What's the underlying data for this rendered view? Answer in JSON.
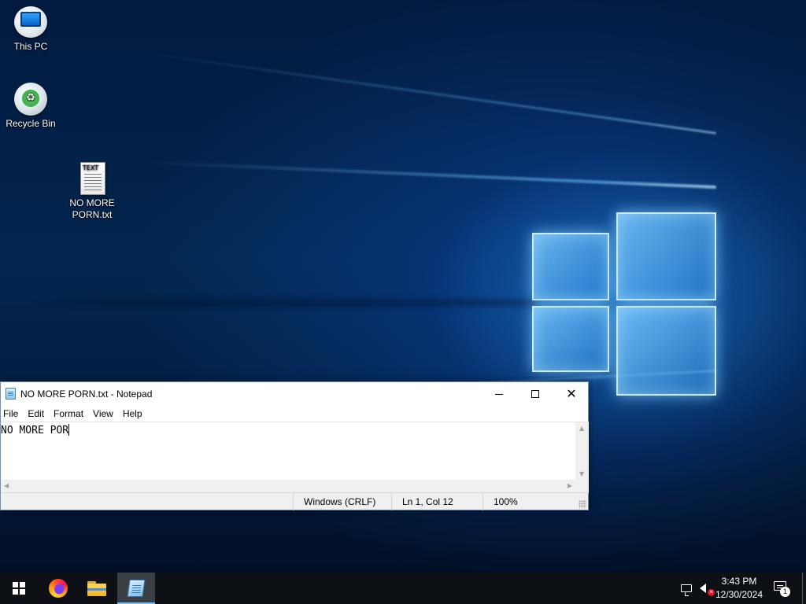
{
  "desktop": {
    "icons": [
      {
        "label": "This PC",
        "icon": "this-pc-icon"
      },
      {
        "label": "Recycle Bin",
        "icon": "recycle-bin-icon"
      },
      {
        "label": "NO MORE PORN.txt",
        "label_line1": "NO MORE",
        "label_line2": "PORN.txt",
        "icon": "text-file-icon",
        "badge": "TEXT"
      }
    ]
  },
  "notepad": {
    "title": "NO MORE PORN.txt - Notepad",
    "menu": [
      "File",
      "Edit",
      "Format",
      "View",
      "Help"
    ],
    "content": "NO MORE POR",
    "status": {
      "encoding": "Windows (CRLF)",
      "position": "Ln 1, Col 12",
      "zoom": "100%"
    }
  },
  "taskbar": {
    "pinned": [
      {
        "name": "Start",
        "icon": "windows-logo-icon"
      },
      {
        "name": "Firefox",
        "icon": "firefox-icon"
      },
      {
        "name": "File Explorer",
        "icon": "folder-icon"
      },
      {
        "name": "Notepad",
        "icon": "notepad-icon",
        "active": true
      }
    ],
    "tray": {
      "network_icon": "network-icon",
      "volume_icon": "volume-muted-icon",
      "time": "3:43 PM",
      "date": "12/30/2024",
      "notification_count": "1"
    }
  },
  "colors": {
    "taskbar_bg": "#0d1115",
    "active_indicator": "#76b9ed",
    "wallpaper_accent": "#2e8fe0"
  }
}
